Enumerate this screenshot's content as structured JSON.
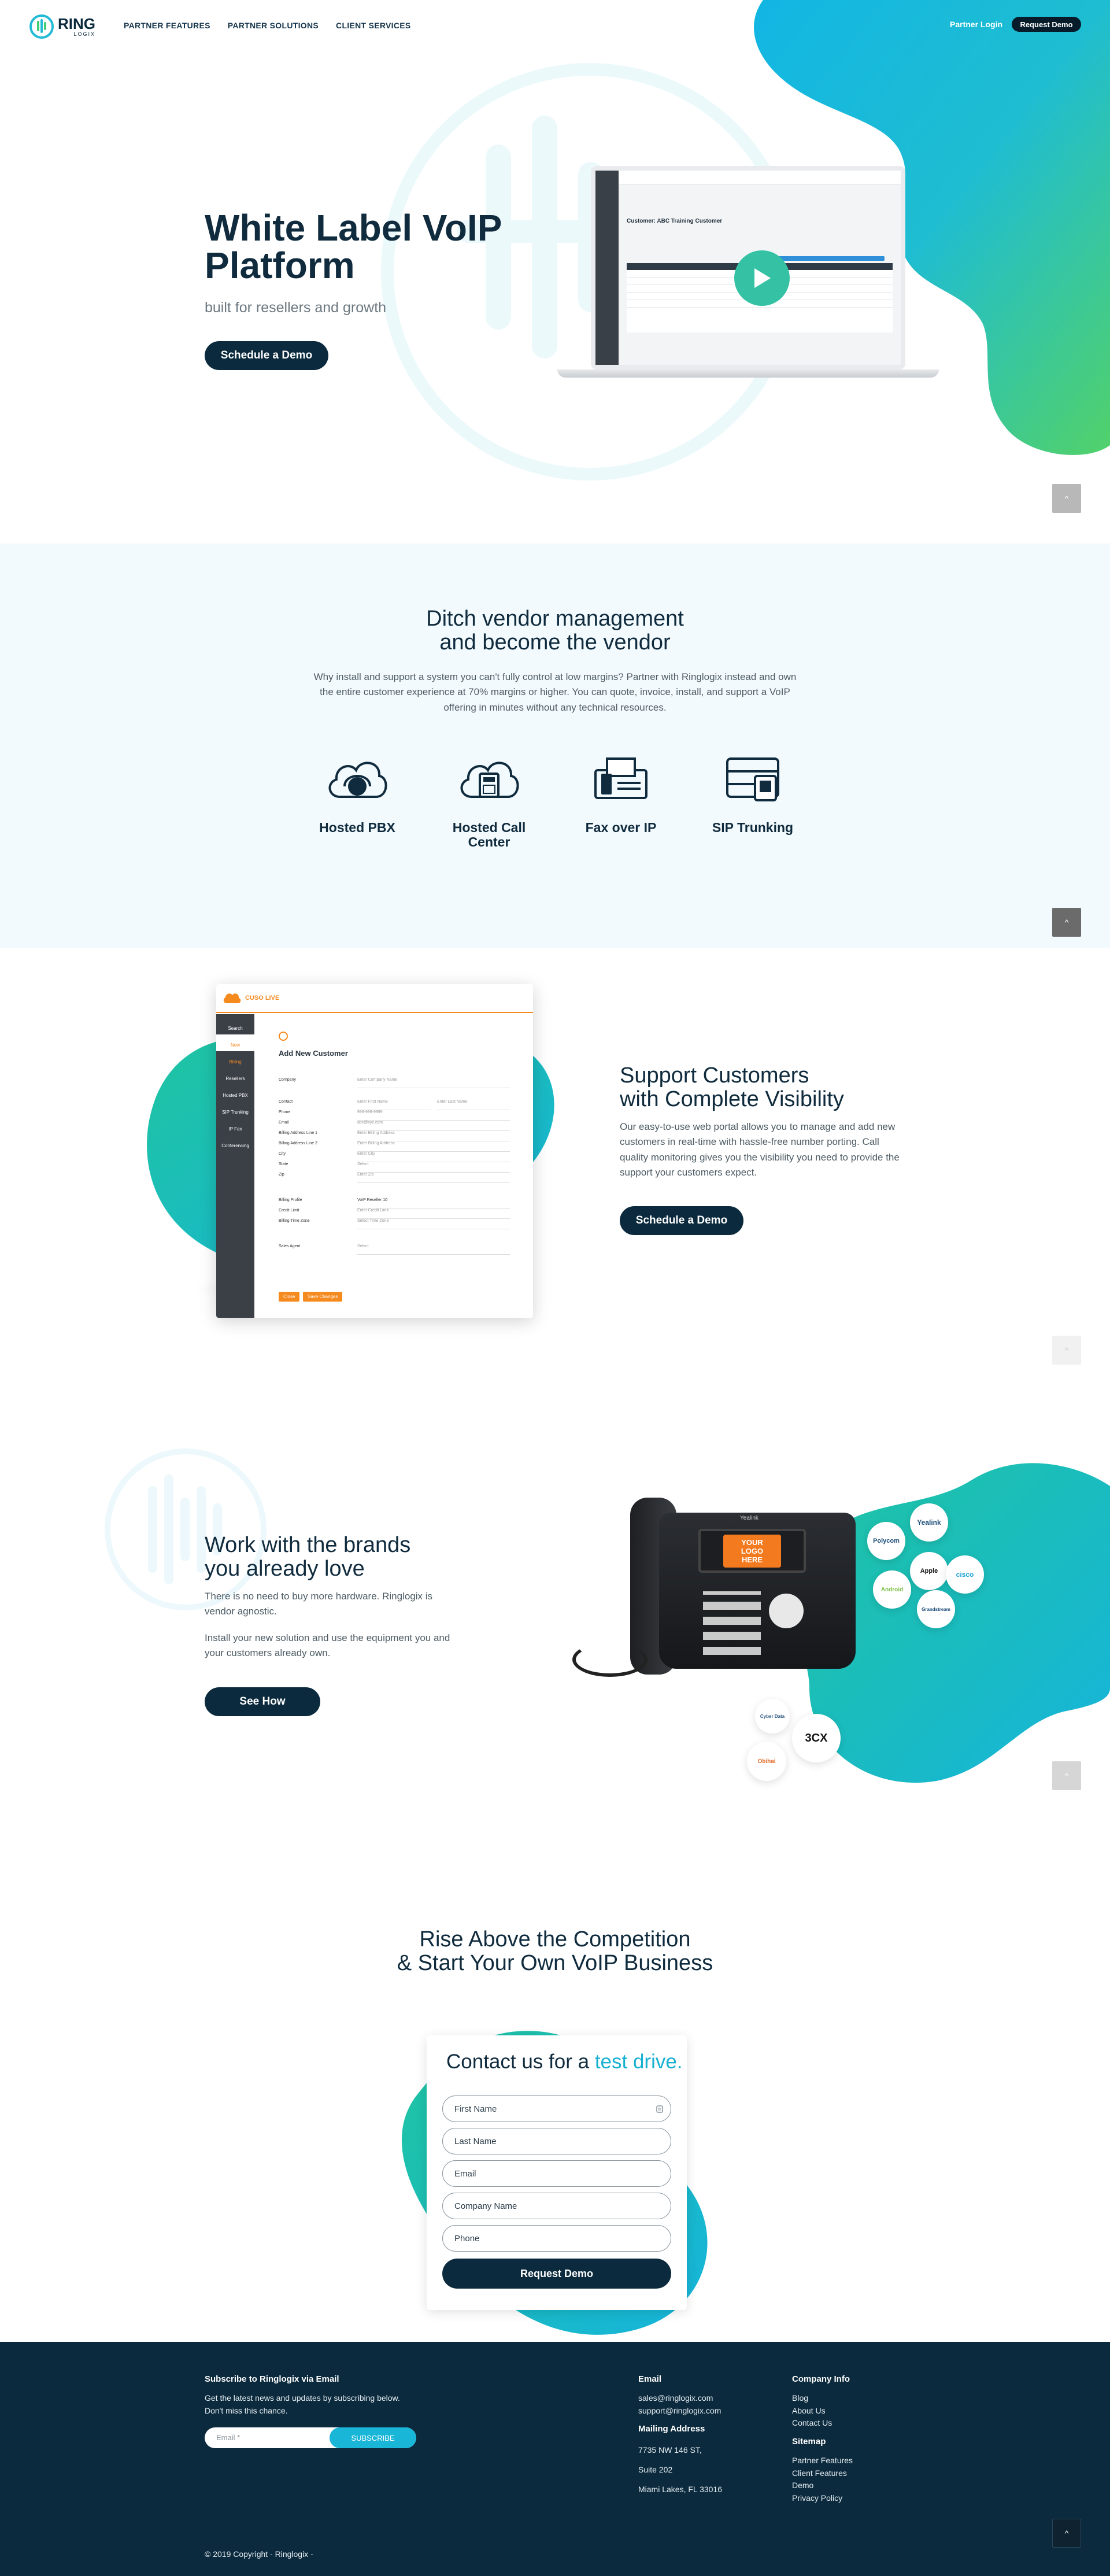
{
  "header": {
    "logo_text": "RING",
    "logo_sub": "LOGIX",
    "nav": [
      "PARTNER FEATURES",
      "PARTNER SOLUTIONS",
      "CLIENT SERVICES"
    ],
    "partner_login": "Partner Login",
    "request_demo": "Request Demo"
  },
  "hero": {
    "title_line1": "White Label VoIP",
    "title_line2": "Platform",
    "subtitle": "built for resellers and growth",
    "cta": "Schedule a Demo",
    "mockup": {
      "customer_title": "Customer: ABC Training Customer",
      "table_headers": [
        "Phone #",
        "Name",
        "Location",
        "Call Recording",
        "Voicemail",
        "Fwd",
        "Action"
      ]
    }
  },
  "vendor": {
    "title_line1": "Ditch vendor management",
    "title_line2": "and become the vendor",
    "body": "Why install and support a system you can't fully control at low margins? Partner with Ringlogix instead and own the entire customer experience at 70% margins or higher. You can quote, invoice, install, and support a VoIP offering in minutes without any technical resources.",
    "services": [
      {
        "label": "Hosted PBX",
        "icon": "cloud-headset-icon"
      },
      {
        "label": "Hosted Call Center",
        "icon": "cloud-phone-icon"
      },
      {
        "label": "Fax over IP",
        "icon": "fax-icon"
      },
      {
        "label": "SIP Trunking",
        "icon": "server-icon"
      }
    ]
  },
  "support": {
    "title_line1": "Support Customers",
    "title_line2": "with Complete Visibility",
    "body": "Our easy-to-use web portal allows you to manage and add new customers in real-time with hassle-free number porting. Call quality monitoring gives you the visibility you need to provide the support your customers expect.",
    "cta": "Schedule a Demo",
    "portal": {
      "logo": "CUSO LIVE",
      "heading": "Add New Customer",
      "sidebar": [
        "Search",
        "New",
        "Billing",
        "Resellers",
        "Hosted PBX",
        "SIP Trunking",
        "IP Fax",
        "Conferencing"
      ],
      "fields": [
        {
          "label": "Company",
          "placeholder": "Enter Company Name"
        },
        {
          "label": "Contact",
          "placeholder": "Enter First Name"
        },
        {
          "label": "Phone",
          "placeholder": "999-999-9999"
        },
        {
          "label": "Email",
          "placeholder": "abc@xyz.com"
        },
        {
          "label": "Billing Address Line 1",
          "placeholder": "Enter Billing Address"
        },
        {
          "label": "Billing Address Line 2",
          "placeholder": "Enter Billing Address"
        },
        {
          "label": "City",
          "placeholder": "Enter City"
        },
        {
          "label": "State",
          "placeholder": "Select"
        },
        {
          "label": "Zip",
          "placeholder": "Enter Zip"
        },
        {
          "label": "Billing Profile",
          "placeholder": "VoIP Reseller 10"
        },
        {
          "label": "Credit Limit",
          "placeholder": "Enter Credit Limit"
        },
        {
          "label": "Billing Time Zone",
          "placeholder": "Select Time Zone"
        },
        {
          "label": "Sales Agent",
          "placeholder": "Select"
        }
      ],
      "contact_last": "Enter Last Name",
      "close_btn": "Close",
      "save_btn": "Save Changes"
    }
  },
  "brands": {
    "title_line1": "Work with the brands",
    "title_line2": "you already love",
    "body1": "There is no need to buy more hardware. Ringlogix is vendor agnostic.",
    "body2": "Install your new solution and use the equipment you and your customers already own.",
    "cta": "See How",
    "phone_screen": "YOUR LOGO HERE",
    "phone_brand": "Yealink",
    "logos": [
      "Yealink",
      "Polycom",
      "Apple",
      "cisco",
      "Android",
      "Grandstream",
      "Cyber Data",
      "3CX",
      "Obihai"
    ]
  },
  "contact": {
    "title_line1": "Rise Above the Competition",
    "title_line2": "& Start Your Own VoIP Business",
    "form_title": "Contact us for a",
    "form_title_accent": "test drive.",
    "fields": [
      "First Name",
      "Last Name",
      "Email",
      "Company Name",
      "Phone"
    ],
    "submit": "Request Demo"
  },
  "footer": {
    "subscribe_title": "Subscribe to Ringlogix via Email",
    "subscribe_text": "Get the latest news and updates by subscribing below. Don't miss this chance.",
    "email_placeholder": "Email *",
    "subscribe_btn": "SUBSCRIBE",
    "email_title": "Email",
    "emails": [
      "sales@ringlogix.com",
      "support@ringlogix.com"
    ],
    "address_title": "Mailing Address",
    "address": [
      "7735 NW 146 ST,",
      "Suite 202",
      "Miami Lakes, FL 33016"
    ],
    "company_title": "Company Info",
    "company_links": [
      "Blog",
      "About Us",
      "Contact Us"
    ],
    "sitemap_title": "Sitemap",
    "sitemap_links": [
      "Partner Features",
      "Client Features",
      "Demo",
      "Privacy Policy"
    ],
    "copyright": "© 2019 Copyright - Ringlogix -"
  },
  "colors": {
    "navy": "#0b2a3d",
    "teal": "#22bbd6",
    "green": "#3fcf73",
    "footer_bg": "#0b2a3d",
    "accent_cyan": "#17b0d0"
  }
}
